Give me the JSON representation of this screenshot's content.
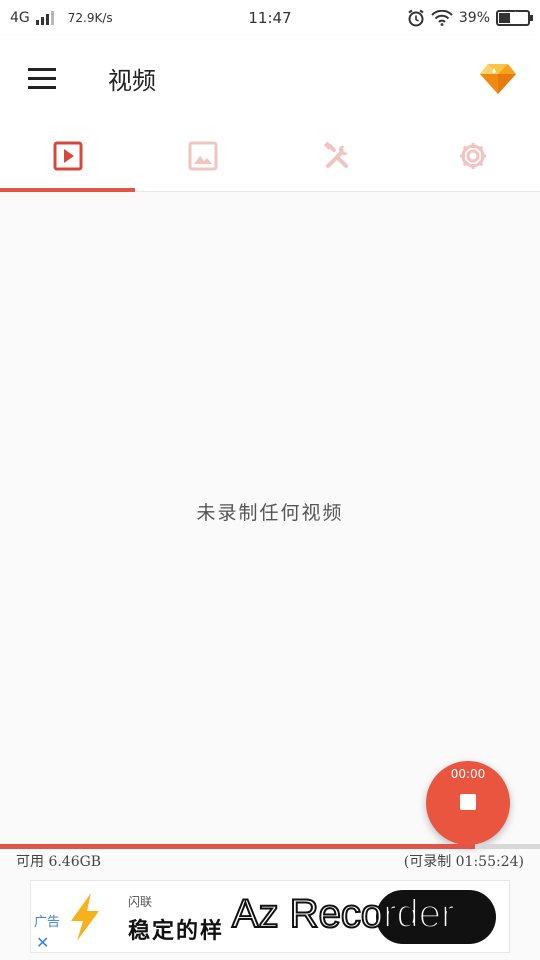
{
  "status_bar": {
    "network": "4G",
    "speed": "72.9K/s",
    "time": "11:47",
    "battery": "39%",
    "battery_level": 0.39
  },
  "app_bar": {
    "title": "视频",
    "menu_icon": "hamburger-menu-icon",
    "premium_icon": "diamond-icon"
  },
  "tabs": [
    {
      "icon": "video-play-icon",
      "active": true
    },
    {
      "icon": "image-icon",
      "active": false
    },
    {
      "icon": "tools-icon",
      "active": false
    },
    {
      "icon": "settings-gear-icon",
      "active": false
    }
  ],
  "empty_state": "未录制任何视频",
  "fab": {
    "timer": "00:00",
    "icon": "stop-icon"
  },
  "storage": {
    "available": "可用 6.46GB",
    "recordable": "(可录制 01:55:24)",
    "used_fraction": 0.88
  },
  "ad": {
    "tag": "广告",
    "close": "✕",
    "brand": "闪联",
    "slogan": "稳定的样",
    "watermark": "Az Recorder"
  },
  "colors": {
    "accent": "#e05548",
    "fab": "#e9553f",
    "ad_blue": "#3a7ee8"
  }
}
